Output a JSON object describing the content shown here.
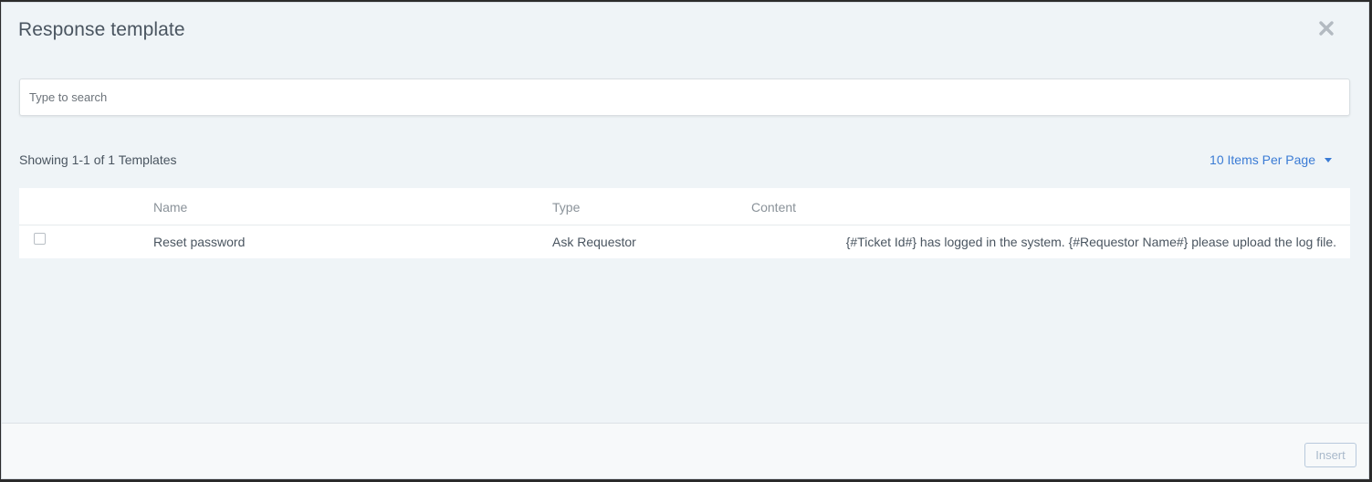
{
  "dialog": {
    "title": "Response template",
    "close_icon": "close-icon"
  },
  "search": {
    "placeholder": "Type to search",
    "value": ""
  },
  "pagination": {
    "showing_text": "Showing 1-1 of 1 Templates",
    "items_per_page_label": "10 Items Per Page",
    "dropdown_icon": "caret-down-icon"
  },
  "table": {
    "columns": [
      "Name",
      "Type",
      "Content"
    ],
    "rows": [
      {
        "checked": false,
        "name": "Reset password",
        "type": "Ask Requestor",
        "content": "{#Ticket Id#} has logged in the system. {#Requestor Name#} please upload the log file."
      }
    ]
  },
  "footer": {
    "insert_label": "Insert",
    "insert_disabled": true
  },
  "colors": {
    "background": "#eff4f7",
    "link": "#3a7bd5",
    "text": "#4a5560",
    "muted": "#8a9299"
  }
}
